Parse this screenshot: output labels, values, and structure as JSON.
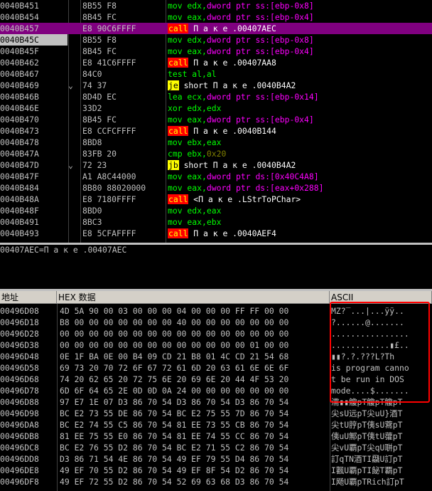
{
  "disasm": {
    "rows": [
      {
        "addr": "0040B451",
        "mark": "",
        "hex": "8B55 F8",
        "parts": [
          {
            "t": "mov edx,",
            "c": "plain"
          },
          {
            "t": "dword ptr ss:[ebp-0x8]",
            "c": "mem"
          }
        ]
      },
      {
        "addr": "0040B454",
        "mark": "",
        "hex": "8B45 FC",
        "parts": [
          {
            "t": "mov eax,",
            "c": "plain"
          },
          {
            "t": "dword ptr ss:[ebp-0x4]",
            "c": "mem"
          }
        ]
      },
      {
        "addr": "0040B457",
        "mark": "",
        "hex": "E8 90C6FFFF",
        "sel": true,
        "parts": [
          {
            "t": "call",
            "c": "hl-red"
          },
          {
            "t": " П а к е .00407AEC",
            "c": "sym"
          }
        ]
      },
      {
        "addr": "0040B45C",
        "mark": "",
        "hex": "8B55 F8",
        "cur": true,
        "parts": [
          {
            "t": "mov edx,",
            "c": "plain"
          },
          {
            "t": "dword ptr ss:[ebp-0x8]",
            "c": "mem"
          }
        ]
      },
      {
        "addr": "0040B45F",
        "mark": "",
        "hex": "8B45 FC",
        "parts": [
          {
            "t": "mov eax,",
            "c": "plain"
          },
          {
            "t": "dword ptr ss:[ebp-0x4]",
            "c": "mem"
          }
        ]
      },
      {
        "addr": "0040B462",
        "mark": "",
        "hex": "E8 41C6FFFF",
        "parts": [
          {
            "t": "call",
            "c": "hl-red"
          },
          {
            "t": " П а к е .00407AA8",
            "c": "sym"
          }
        ]
      },
      {
        "addr": "0040B467",
        "mark": "",
        "hex": "84C0",
        "parts": [
          {
            "t": "test al,al",
            "c": "plain"
          }
        ]
      },
      {
        "addr": "0040B469",
        "mark": "⌄",
        "hex": "74 37",
        "parts": [
          {
            "t": "je",
            "c": "hl-yel"
          },
          {
            "t": " short П а к е .0040B4A2",
            "c": "sym"
          }
        ]
      },
      {
        "addr": "0040B46B",
        "mark": "",
        "hex": "8D4D EC",
        "parts": [
          {
            "t": "lea ecx,",
            "c": "plain"
          },
          {
            "t": "dword ptr ss:[ebp-0x14]",
            "c": "mem"
          }
        ]
      },
      {
        "addr": "0040B46E",
        "mark": "",
        "hex": "33D2",
        "parts": [
          {
            "t": "xor edx,edx",
            "c": "plain"
          }
        ]
      },
      {
        "addr": "0040B470",
        "mark": "",
        "hex": "8B45 FC",
        "parts": [
          {
            "t": "mov eax,",
            "c": "plain"
          },
          {
            "t": "dword ptr ss:[ebp-0x4]",
            "c": "mem"
          }
        ]
      },
      {
        "addr": "0040B473",
        "mark": "",
        "hex": "E8 CCFCFFFF",
        "parts": [
          {
            "t": "call",
            "c": "hl-red"
          },
          {
            "t": " П а к е .0040B144",
            "c": "sym"
          }
        ]
      },
      {
        "addr": "0040B478",
        "mark": "",
        "hex": "8BD8",
        "parts": [
          {
            "t": "mov ebx,eax",
            "c": "plain"
          }
        ]
      },
      {
        "addr": "0040B47A",
        "mark": "",
        "hex": "83FB 20",
        "parts": [
          {
            "t": "cmp ebx,",
            "c": "plain"
          },
          {
            "t": "0x20",
            "c": "num-s"
          }
        ]
      },
      {
        "addr": "0040B47D",
        "mark": "⌄",
        "hex": "72 23",
        "parts": [
          {
            "t": "jb",
            "c": "hl-yel"
          },
          {
            "t": " short П а к е .0040B4A2",
            "c": "sym"
          }
        ]
      },
      {
        "addr": "0040B47F",
        "mark": "",
        "hex": "A1 A8C44000",
        "parts": [
          {
            "t": "mov eax,",
            "c": "plain"
          },
          {
            "t": "dword ptr ds:[0x40C4A8]",
            "c": "mem"
          }
        ]
      },
      {
        "addr": "0040B484",
        "mark": "",
        "hex": "8B80 88020000",
        "parts": [
          {
            "t": "mov eax,",
            "c": "plain"
          },
          {
            "t": "dword ptr ds:[eax+0x288]",
            "c": "mem"
          }
        ]
      },
      {
        "addr": "0040B48A",
        "mark": "",
        "hex": "E8 7180FFFF",
        "parts": [
          {
            "t": "call",
            "c": "hl-red"
          },
          {
            "t": " <П а к е .LStrToPChar>",
            "c": "sym"
          }
        ]
      },
      {
        "addr": "0040B48F",
        "mark": "",
        "hex": "8BD0",
        "parts": [
          {
            "t": "mov edx,eax",
            "c": "plain"
          }
        ]
      },
      {
        "addr": "0040B491",
        "mark": "",
        "hex": "8BC3",
        "parts": [
          {
            "t": "mov eax,ebx",
            "c": "plain"
          }
        ]
      },
      {
        "addr": "0040B493",
        "mark": "",
        "hex": "E8 5CFAFFFF",
        "parts": [
          {
            "t": "call",
            "c": "hl-red"
          },
          {
            "t": " П а к е .0040AEF4",
            "c": "sym"
          }
        ]
      }
    ]
  },
  "info": {
    "text": "00407AEC=П а к е .00407AEC"
  },
  "dump": {
    "headers": {
      "address": "地址",
      "hex": "HEX 数据",
      "ascii": "ASCII"
    },
    "rows": [
      {
        "addr": "00496D08",
        "hex": "4D 5A 90 00 03 00 00 00 04 00 00 00 FF FF 00 00",
        "ascii": "MZ?‾...|...ÿÿ.."
      },
      {
        "addr": "00496D18",
        "hex": "B8 00 00 00 00 00 00 00 40 00 00 00 00 00 00 00",
        "ascii": "?......@......."
      },
      {
        "addr": "00496D28",
        "hex": "00 00 00 00 00 00 00 00 00 00 00 00 00 00 00 00",
        "ascii": "................"
      },
      {
        "addr": "00496D38",
        "hex": "00 00 00 00 00 00 00 00 00 00 00 00 00 01 00 00",
        "ascii": "............▮£.."
      },
      {
        "addr": "00496D48",
        "hex": "0E 1F BA 0E 00 B4 09 CD 21 B8 01 4C CD 21 54 68",
        "ascii": "▮▮?.?.???L?Th"
      },
      {
        "addr": "00496D58",
        "hex": "69 73 20 70 72 6F 67 72 61 6D 20 63 61 6E 6E 6F",
        "ascii": "is program canno"
      },
      {
        "addr": "00496D68",
        "hex": "74 20 62 65 20 72 75 6E 20 69 6E 20 44 4F 53 20",
        "ascii": "t be run in DOS "
      },
      {
        "addr": "00496D78",
        "hex": "6D 6F 64 65 2E 0D 0D 0A 24 00 00 00 00 00 00 00",
        "ascii": "mode....$......."
      },
      {
        "addr": "00496D88",
        "hex": "97 E7 1E 07 D3 86 70 54 D3 86 70 54 D3 86 70 54",
        "ascii": "濡▮▮觼pT觼pT觼pT"
      },
      {
        "addr": "00496D98",
        "hex": "BC E2 73 55 DE 86 70 54 BC E2 75 55 7D 86 70 54",
        "ascii": "尖sU远pT尖uU}酒T"
      },
      {
        "addr": "00496DA8",
        "hex": "BC E2 74 55 C5 86 70 54 81 EE 73 55 CB 86 70 54",
        "ascii": "尖tU脝pT侇sU藛pT"
      },
      {
        "addr": "00496DB8",
        "hex": "81 EE 75 55 E0 86 70 54 81 EE 74 55 CC 86 70 54",
        "ascii": "侇uU鄦pT侇tU虇pT"
      },
      {
        "addr": "00496DC8",
        "hex": "BC E2 76 55 D2 86 70 54 BC E2 71 55 C2 86 70 54",
        "ascii": "尖vU覇pT尖qU聠pT"
      },
      {
        "addr": "00496DD8",
        "hex": "D3 86 71 54 4E 86 70 54 49 EF 79 55 D4 86 70 54",
        "ascii": "訂qTN酒TI飝U訂pT"
      },
      {
        "addr": "00496DE8",
        "hex": "49 EF 70 55 D2 86 70 54 49 EF 8F 54 D2 86 70 54",
        "ascii": "I飌U覇pTI飶T覇pT"
      },
      {
        "addr": "00496DF8",
        "hex": "49 EF 72 55 D2 86 70 54 52 69 63 68 D3 86 70 54",
        "ascii": "I飏U覇pTRich訂pT"
      }
    ]
  }
}
